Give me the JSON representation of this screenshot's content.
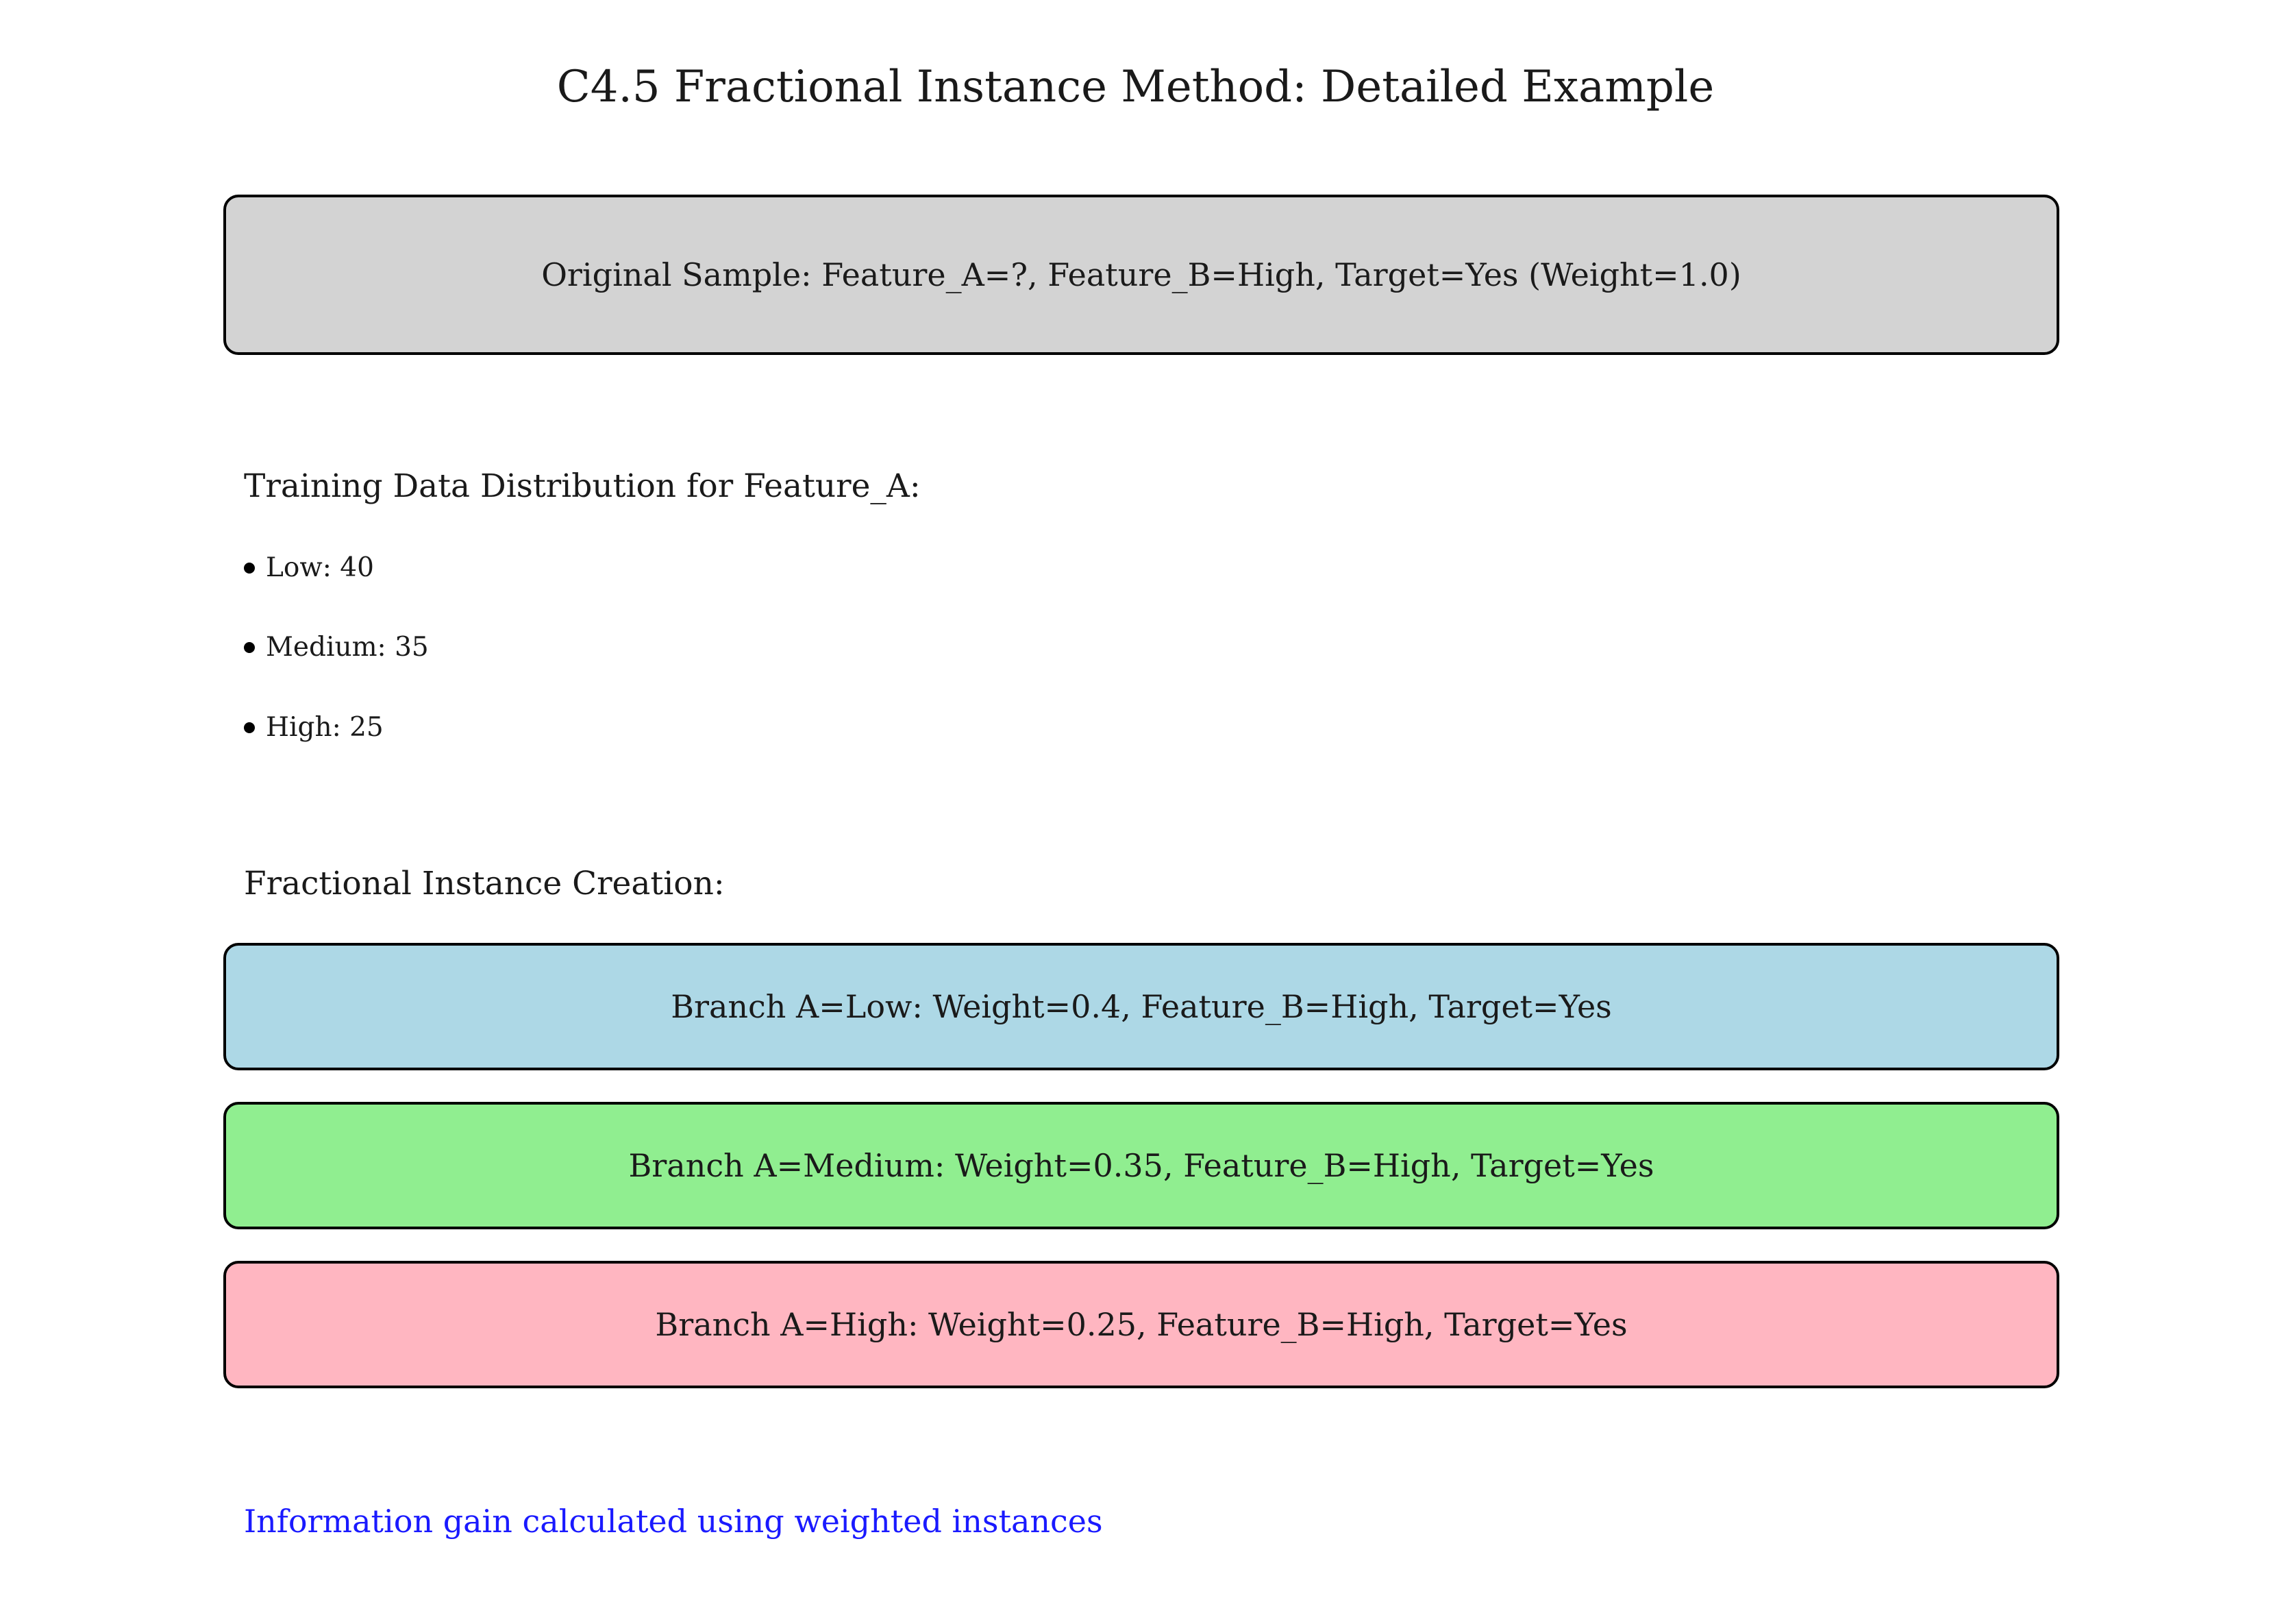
{
  "title": "C4.5 Fractional Instance Method: Detailed Example",
  "original_sample": "Original Sample: Feature_A=?, Feature_B=High, Target=Yes (Weight=1.0)",
  "distribution": {
    "heading": "Training Data Distribution for Feature_A:",
    "items": [
      {
        "label": "Low: 40"
      },
      {
        "label": "Medium: 35"
      },
      {
        "label": "High: 25"
      }
    ]
  },
  "fractional": {
    "heading": "Fractional Instance Creation:",
    "branches": [
      {
        "label": "Branch A=Low: Weight=0.4, Feature_B=High, Target=Yes",
        "color": "#add8e6"
      },
      {
        "label": "Branch A=Medium: Weight=0.35, Feature_B=High, Target=Yes",
        "color": "#90ee90"
      },
      {
        "label": "Branch A=High: Weight=0.25, Feature_B=High, Target=Yes",
        "color": "#ffb6c1"
      }
    ]
  },
  "original_color": "#d3d3d3",
  "footer": {
    "text": "Information gain calculated using weighted instances",
    "color": "#1a1aff"
  }
}
